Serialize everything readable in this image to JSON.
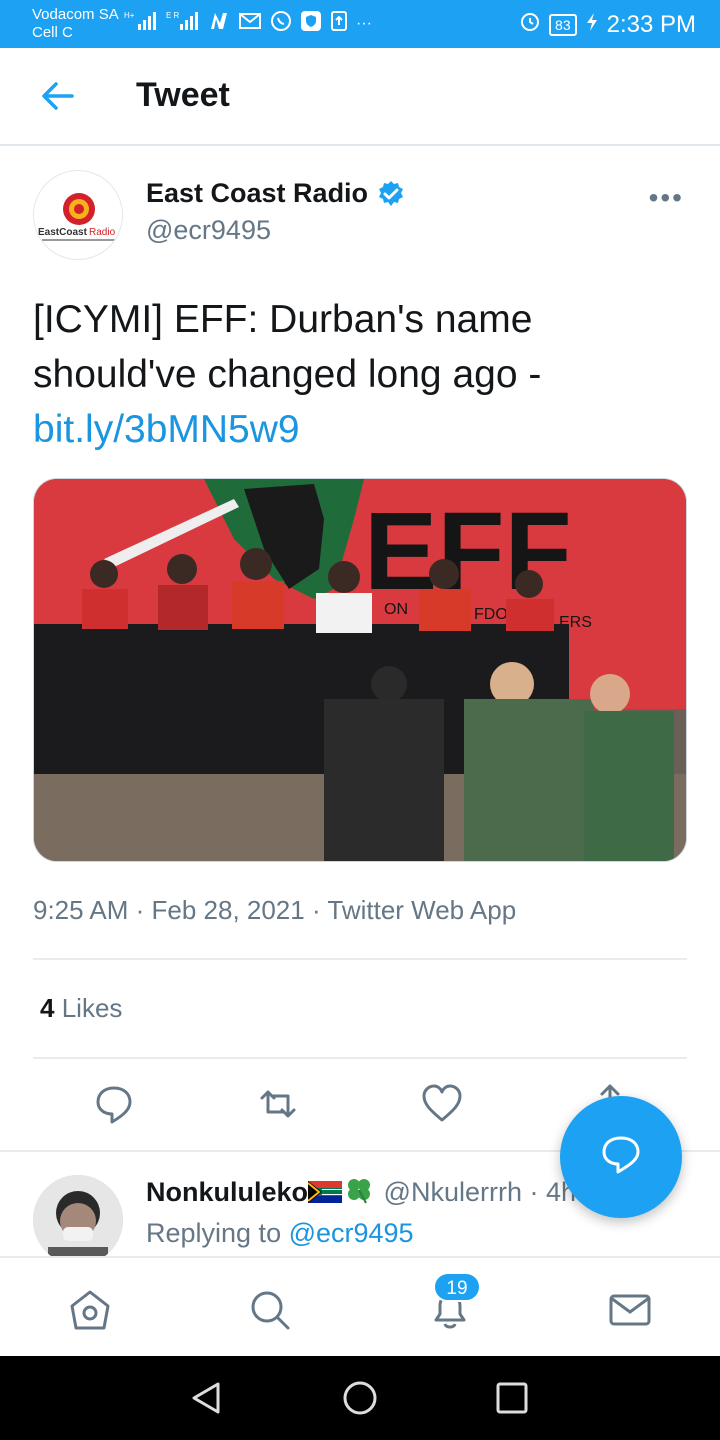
{
  "status_bar": {
    "carrier_line1": "Vodacom SA",
    "carrier_line2": "Cell C",
    "battery": "83",
    "time": "2:33 PM"
  },
  "header": {
    "title": "Tweet"
  },
  "tweet": {
    "author_name": "East Coast Radio",
    "author_handle": "@ecr9495",
    "text_prefix": "[ICYMI] EFF: Durban's name should've changed long ago - ",
    "link": "bit.ly/3bMN5w9",
    "meta": "9:25 AM · Feb 28, 2021 · Twitter Web App",
    "likes_count": "4",
    "likes_label": "Likes",
    "image_banner_text": "EFF",
    "banner_partial_1": "ON",
    "banner_partial_2": "FDO",
    "banner_partial_3": "ERS"
  },
  "reply": {
    "name": "Nonkululeko",
    "handle": "@Nkulerrrh · 4h",
    "replying_prefix": "Replying to ",
    "replying_to": "@ecr9495"
  },
  "bottom_nav": {
    "notifications_badge": "19"
  },
  "colors": {
    "accent": "#1da1f2",
    "link": "#1b95e0",
    "text_primary": "#14171a",
    "text_secondary": "#657786"
  }
}
